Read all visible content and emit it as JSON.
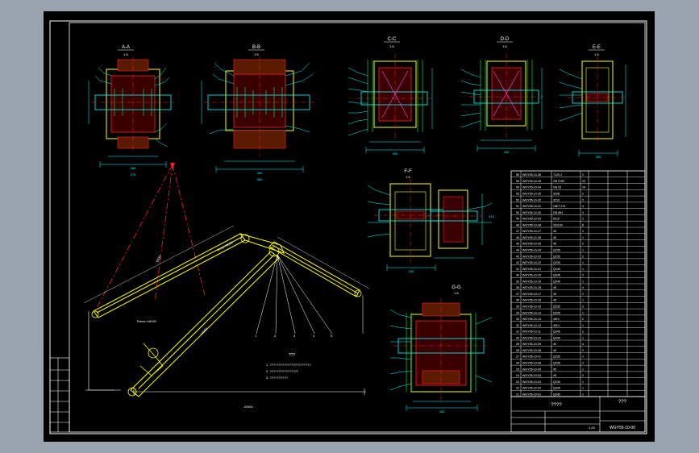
{
  "colors": {
    "background": "#000000",
    "frame": "#ffffff",
    "cyan": "#00ffff",
    "yellow": "#ffff00",
    "red": "#ff2020",
    "magenta": "#ff40ff",
    "green": "#00ff40"
  },
  "sections": {
    "a": {
      "title": "A-A",
      "scale": "1:5"
    },
    "b": {
      "title": "B-B",
      "scale": "1:5"
    },
    "c": {
      "title": "C-C",
      "scale": "1:5"
    },
    "d": {
      "title": "D-D",
      "scale": "1:5"
    },
    "e": {
      "title": "E-E",
      "scale": "1:5"
    },
    "f": {
      "title": "F-F",
      "scale": "1:5"
    },
    "g": {
      "title": "G-G",
      "scale": "1:5"
    }
  },
  "dimensions": {
    "a_bottom": "280",
    "a_top": "174",
    "b_bottom": "460",
    "b_top": "580",
    "c_bottom": "400",
    "d_bottom": "400",
    "e_bottom": "300",
    "f_bottom": "300",
    "f_side": "310",
    "g_bottom": "400",
    "boom_lower": "Rmax=16000",
    "boom_upper": "Hmax=9000",
    "jib": "5500",
    "main": "12000",
    "radius": "20000"
  },
  "tech_notes": {
    "heading": "???",
    "lines": [
      "1. ???????????????????????",
      "2. ????????????????",
      "3. ??????????"
    ]
  },
  "title_block": {
    "drawing_no": "WGY55-10-00",
    "name": "????",
    "scale": "1:20",
    "sheet": "???"
  },
  "bom_rows": [
    [
      "56",
      "WGY55-10-36",
      "7120-2",
      "1"
    ],
    [
      "55",
      "WGY55-10-35",
      "GB 5782",
      "24"
    ],
    [
      "54",
      "WGY55-10-34",
      "GB 93",
      "24"
    ],
    [
      "53",
      "WGY55-10-33",
      "3208",
      "2"
    ],
    [
      "52",
      "WGY55-10-32",
      "3210",
      "2"
    ],
    [
      "51",
      "WGY55-10-31",
      "GB/T 276",
      "4"
    ],
    [
      "50",
      "WGY55-10-30",
      "GB 894",
      "4"
    ],
    [
      "49",
      "WGY55-10-29",
      "6210",
      "2"
    ],
    [
      "48",
      "WGY55-10-28",
      "25x100",
      "8"
    ],
    [
      "47",
      "WGY55-10-27",
      "45",
      "1"
    ],
    [
      "46",
      "WGY55-10-26",
      "45",
      "1"
    ],
    [
      "45",
      "WGY55-10-25",
      "45",
      "2"
    ],
    [
      "44",
      "WGY55-10-24",
      "Q235",
      "1"
    ],
    [
      "43",
      "WGY55-10-23",
      "Q235",
      "2"
    ],
    [
      "42",
      "WGY55-10-22",
      "Q235",
      "1"
    ],
    [
      "41",
      "WGY55-10-21",
      "Q345",
      "1"
    ],
    [
      "40",
      "WGY55-10-20",
      "Q345",
      "2"
    ],
    [
      "39",
      "WGY55-10-19",
      "Q345",
      "1"
    ],
    [
      "38",
      "WGY55-10-18",
      "45",
      "4"
    ],
    [
      "37",
      "WGY55-10-17",
      "45",
      "2"
    ],
    [
      "36",
      "WGY55-10-16",
      "45",
      "1"
    ],
    [
      "35",
      "WGY55-10-15",
      "Q235",
      "2"
    ],
    [
      "34",
      "WGY55-10-14",
      "Q235",
      "1"
    ],
    [
      "33",
      "WGY55-10-13",
      "40Cr",
      "2"
    ],
    [
      "32",
      "WGY55-10-12",
      "40Cr",
      "1"
    ],
    [
      "31",
      "WGY55-10-11",
      "Q345",
      "2"
    ],
    [
      "30",
      "WGY55-10-10",
      "Q345",
      "1"
    ],
    [
      "29",
      "WGY55-10-09",
      "45",
      "4"
    ],
    [
      "28",
      "WGY55-10-08",
      "45",
      "2"
    ],
    [
      "27",
      "WGY55-10-07",
      "Q235",
      "1"
    ],
    [
      "26",
      "WGY55-10-06",
      "Q235",
      "2"
    ],
    [
      "25",
      "WGY55-10-05",
      "45",
      "1"
    ],
    [
      "24",
      "WGY55-10-04",
      "45",
      "2"
    ],
    [
      "23",
      "WGY55-10-03",
      "Q345",
      "1"
    ],
    [
      "22",
      "WGY55-10-02",
      "Q345",
      "1"
    ],
    [
      "21",
      "WGY55-10-01",
      "Q345",
      "1"
    ]
  ]
}
